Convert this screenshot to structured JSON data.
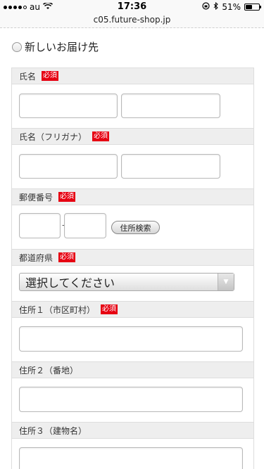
{
  "status_bar": {
    "carrier": "au",
    "time": "17:36",
    "battery_percent": "51%",
    "battery_level": 0.51
  },
  "browser": {
    "url": "c05.future-shop.jp"
  },
  "form": {
    "title": "新しいお届け先",
    "required_badge": "必須",
    "name_label": "氏名",
    "kana_label": "氏名（フリガナ）",
    "postal_label": "郵便番号",
    "postal_dash": "-",
    "address_search_button": "住所検索",
    "prefecture_label": "都道府県",
    "prefecture_select_value": "選択してください",
    "address1_label": "住所１（市区町村）",
    "address2_label": "住所２（番地）",
    "address3_label": "住所３（建物名）"
  },
  "icons": {
    "wifi": "wifi-icon",
    "lock": "orientation-lock-icon",
    "bluetooth": "bluetooth-icon",
    "battery": "battery-icon",
    "select_arrow": "chevron-down-icon"
  }
}
